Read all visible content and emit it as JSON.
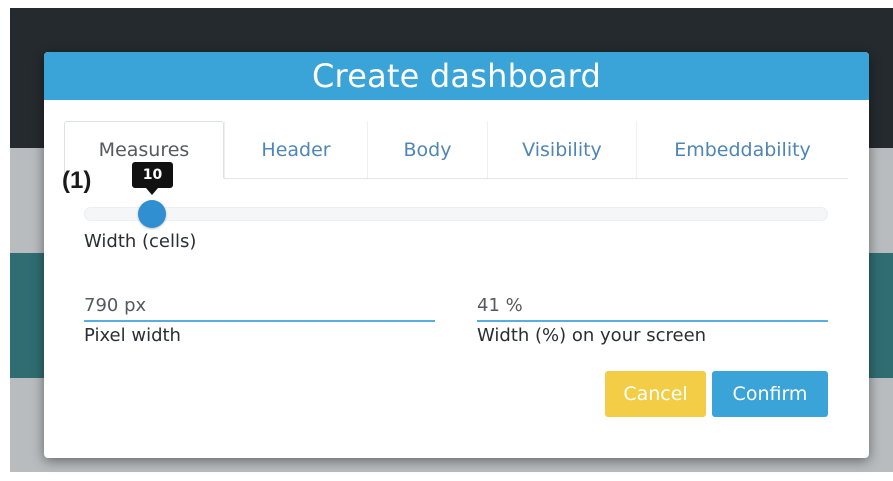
{
  "dialog": {
    "title": "Create dashboard"
  },
  "tabs": [
    {
      "label": "Measures",
      "active": true
    },
    {
      "label": "Header",
      "active": false
    },
    {
      "label": "Body",
      "active": false
    },
    {
      "label": "Visibility",
      "active": false
    },
    {
      "label": "Embeddability",
      "active": false
    }
  ],
  "annotation": "(1)",
  "slider": {
    "value": "10",
    "label": "Width (cells)"
  },
  "fields": {
    "pixel_width": {
      "value": "790 px",
      "label": "Pixel width"
    },
    "percent_width": {
      "value": "41 %",
      "label": "Width (%) on your screen"
    }
  },
  "buttons": {
    "cancel": "Cancel",
    "confirm": "Confirm"
  },
  "colors": {
    "header": "#3aa3d7",
    "tab_text": "#4f86b6",
    "slider_handle": "#2f8fd0",
    "cancel_button": "#f2cd45",
    "confirm_button": "#3aa3d7"
  }
}
